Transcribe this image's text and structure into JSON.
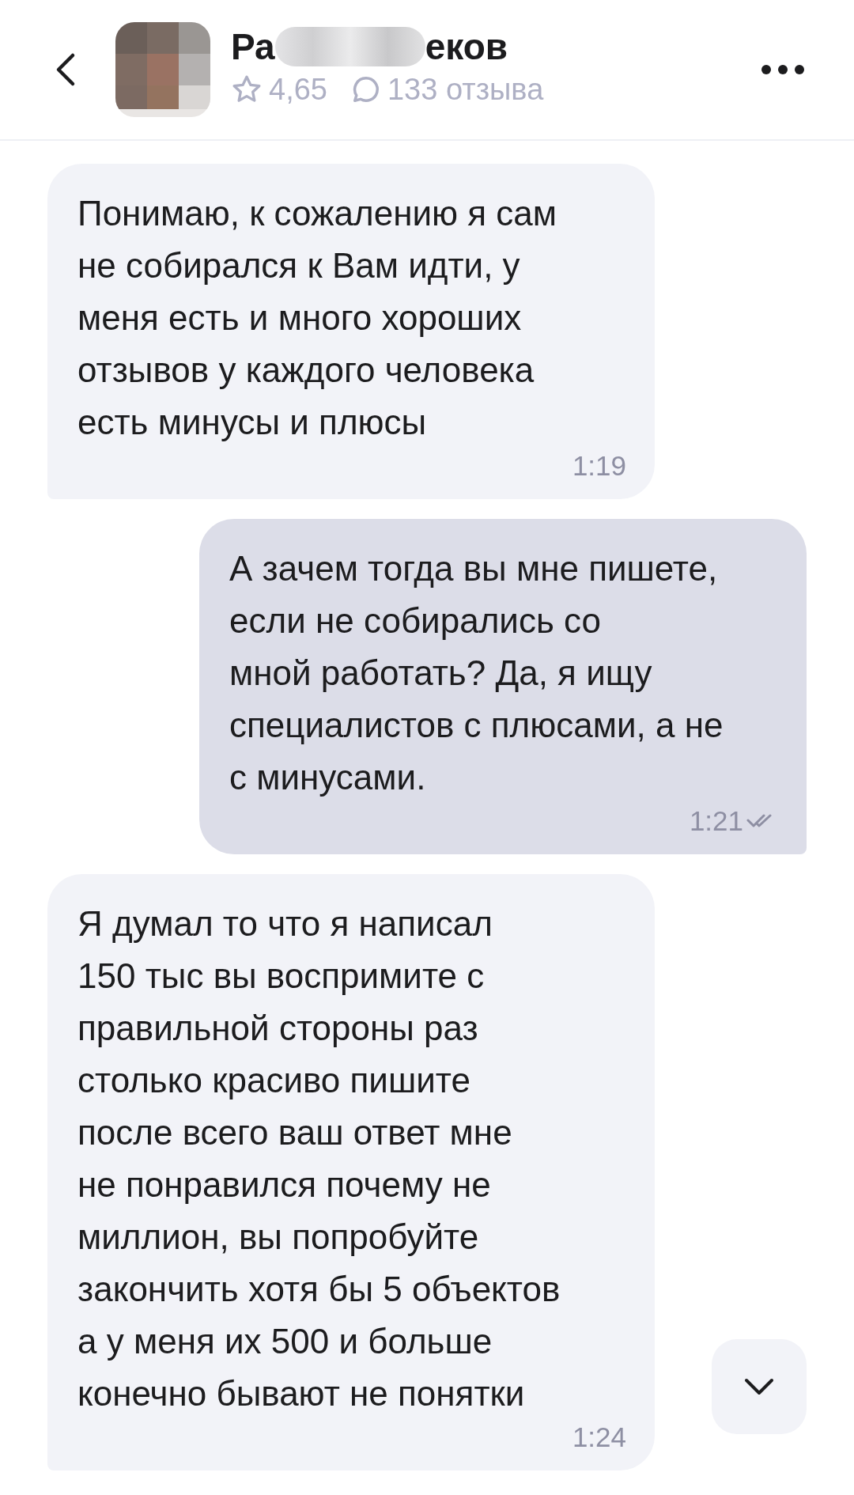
{
  "header": {
    "name_start": "Ра",
    "name_end": "еков",
    "name_blurred": true,
    "rating": "4,65",
    "reviews": "133 отзыва"
  },
  "messages": [
    {
      "kind": "incoming",
      "text": "Понимаю, к сожалению я сам\nне собирался к Вам идти, у\nменя есть и много хороших\nотзывов у каждого человека\nесть минусы и плюсы",
      "time": "1:19"
    },
    {
      "kind": "outgoing",
      "text": "А зачем тогда вы мне пишете,\nесли не собирались со\nмной работать? Да, я ищу\nспециалистов с плюсами, а не\nс минусами.",
      "time": "1:21",
      "read": true
    },
    {
      "kind": "incoming",
      "text": "Я думал то что я написал\n150 тыс вы воспримите с\nправильной стороны раз\nстолько красиво пишите\nпосле всего ваш ответ мне\nне понравился почему не\nмиллион, вы попробуйте\nзакончить хотя бы 5 объектов\nа у меня их 500 и больше\nконечно бывают не понятки",
      "time": "1:24"
    }
  ]
}
